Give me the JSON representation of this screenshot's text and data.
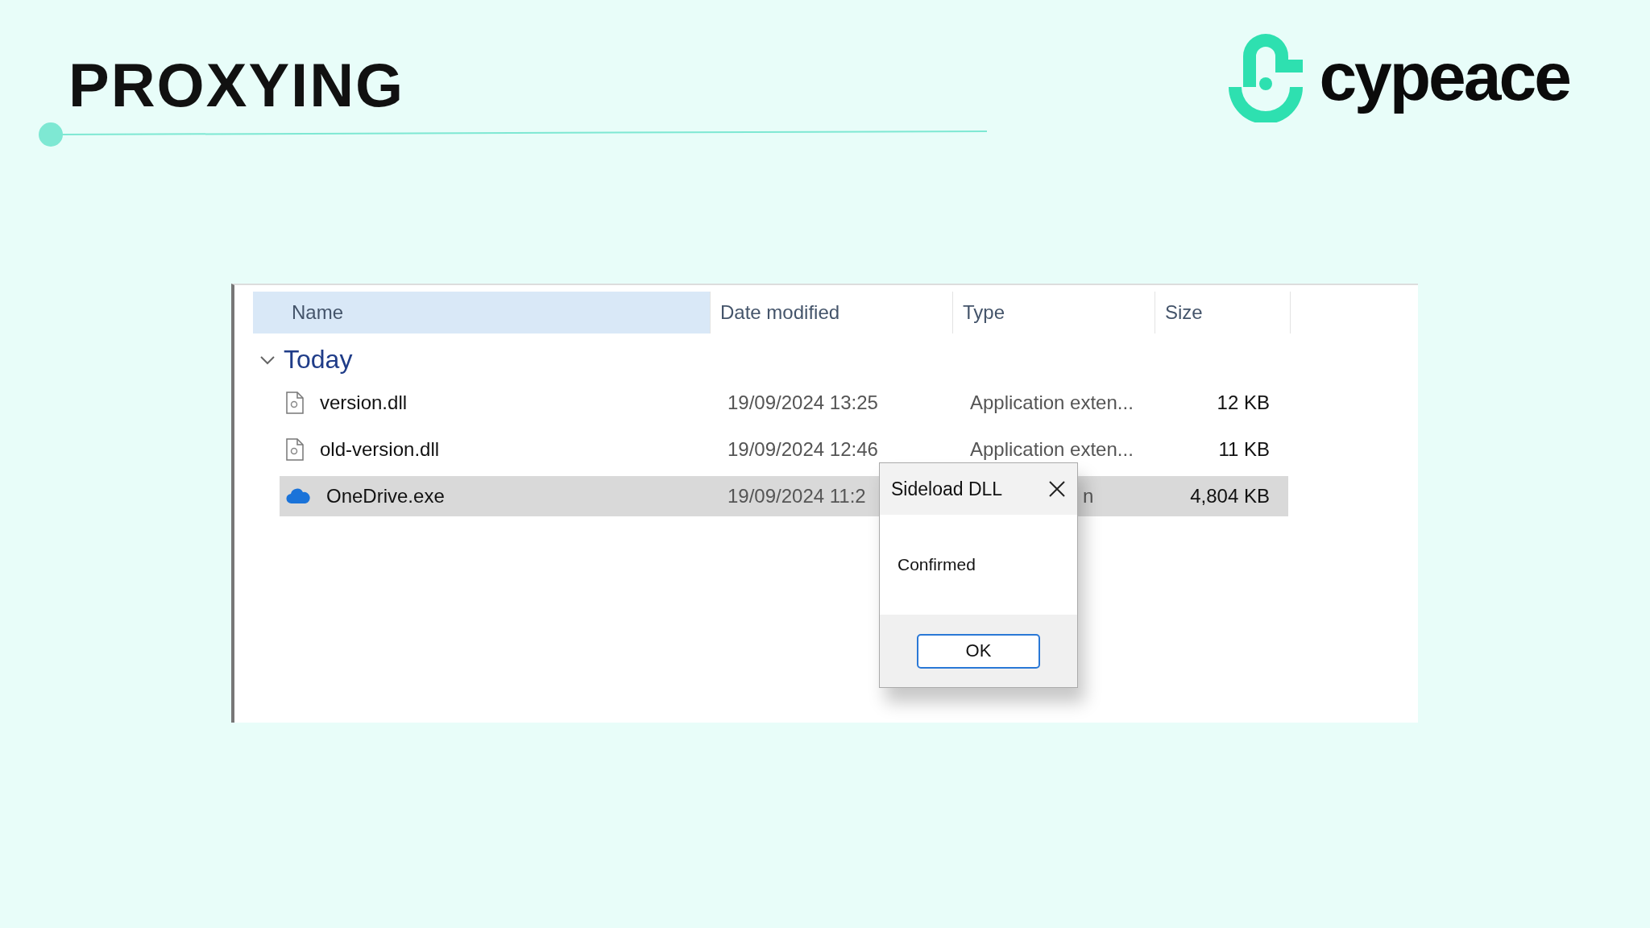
{
  "slide": {
    "title": "PROXYING",
    "brand": "cypeace"
  },
  "explorer": {
    "columns": [
      {
        "label": "Name",
        "sorted": true
      },
      {
        "label": "Date modified",
        "sorted": false
      },
      {
        "label": "Type",
        "sorted": false
      },
      {
        "label": "Size",
        "sorted": false
      }
    ],
    "group": {
      "label": "Today",
      "expanded": true
    },
    "rows": [
      {
        "kind": "dll",
        "name": "version.dll",
        "date": "19/09/2024 13:25",
        "type": "Application exten...",
        "size": "12 KB",
        "selected": false,
        "under_dialog": false
      },
      {
        "kind": "dll",
        "name": "old-version.dll",
        "date": "19/09/2024 12:46",
        "type": "Application exten...",
        "size": "11 KB",
        "selected": false,
        "under_dialog": false
      },
      {
        "kind": "cloud",
        "name": "OneDrive.exe",
        "date": "19/09/2024 11:2",
        "type": "n",
        "size": "4,804 KB",
        "selected": true,
        "under_dialog": true
      }
    ]
  },
  "dialog": {
    "title": "Sideload DLL",
    "message": "Confirmed",
    "button": "OK"
  }
}
